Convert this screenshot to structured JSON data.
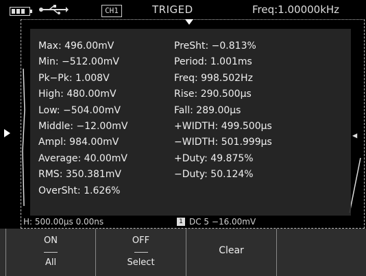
{
  "header": {
    "channel_badge": "CH1",
    "trigger_status": "TRIGED",
    "frequency": "Freq:1.00000kHz"
  },
  "icons": {
    "battery": "battery-icon",
    "usb": "usb-icon"
  },
  "measurements": {
    "left": [
      "Max: 496.00mV",
      "Min: −512.00mV",
      "Pk−Pk: 1.008V",
      "High: 480.00mV",
      "Low: −504.00mV",
      "Middle: −12.00mV",
      "Ampl: 984.00mV",
      "Average: 40.00mV",
      "RMS: 350.381mV",
      "OverSht: 1.626%"
    ],
    "right": [
      "PreSht: −0.813%",
      "Period: 1.001ms",
      "Freq: 998.502Hz",
      "Rise: 290.500µs",
      "Fall: 289.00µs",
      "+WIDTH: 499.500µs",
      "−WIDTH: 501.999µs",
      "+Duty: 49.875%",
      "−Duty: 50.124%"
    ]
  },
  "status_line": {
    "timebase": "H: 500.00µs 0.00ns",
    "channel_num": "1",
    "channel_info": "DC 5  −16.00mV"
  },
  "softkeys": {
    "key1_top": "ON",
    "key1_bottom": "All",
    "key2_top": "OFF",
    "key2_bottom": "Select",
    "key3_label": "Clear"
  }
}
